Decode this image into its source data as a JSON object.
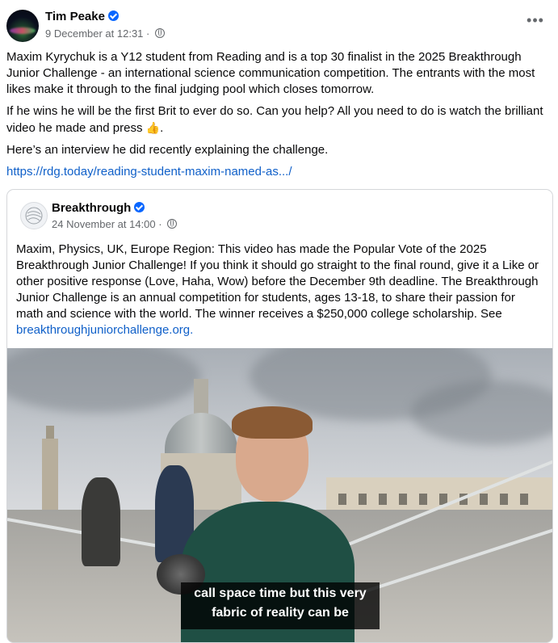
{
  "post": {
    "author": "Tim Peake",
    "timestamp": "9 December at 12:31 ·",
    "paragraphs": [
      "Maxim Kyrychuk is a Y12 student from Reading and is a top 30 finalist in the 2025 Breakthrough Junior Challenge - an international science communication competition. The entrants with the most likes make it through to the final judging pool which closes tomorrow.",
      "If he wins he will be the first Brit to ever do so. Can you help? All you need to do is watch the brilliant video he made and press",
      "Here’s an interview he did recently explaining the challenge."
    ],
    "emoji": "👍",
    "link": "https://rdg.today/reading-student-maxim-named-as.../"
  },
  "shared": {
    "author": "Breakthrough",
    "timestamp": "24 November at 14:00 ·",
    "text": "Maxim, Physics, UK, Europe Region:  This video has made the Popular Vote of the 2025 Breakthrough Junior Challenge! If you think it should go straight to the final round, give it a Like or other positive response (Love, Haha, Wow) before the December 9th deadline. The Breakthrough Junior Challenge is an annual competition for students, ages 13-18, to share their passion for math and science with the world. The winner receives a $250,000 college scholarship. See",
    "link": "breakthroughjuniorchallenge.org.",
    "caption_line1": "call space time but this very",
    "caption_line2": "fabric of reality can be"
  },
  "icons": {
    "verified": "verified-badge-icon",
    "globe": "globe-icon",
    "more": "more-options-icon"
  },
  "colors": {
    "link": "#1060c9",
    "verified": "#0866ff",
    "secondary_text": "#65686c"
  }
}
